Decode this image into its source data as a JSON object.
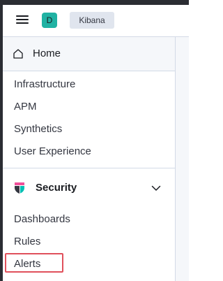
{
  "header": {
    "menu_icon": "hamburger-menu-icon",
    "space_avatar_letter": "D",
    "space_avatar_color": "#20b2a3",
    "app_badge": "Kibana"
  },
  "nav": {
    "home": {
      "icon": "home-icon",
      "label": "Home"
    },
    "observability_items": [
      {
        "label": "Infrastructure"
      },
      {
        "label": "APM"
      },
      {
        "label": "Synthetics"
      },
      {
        "label": "User Experience"
      }
    ],
    "security": {
      "icon": "security-logo-icon",
      "label": "Security",
      "expanded": true,
      "items": [
        {
          "label": "Dashboards"
        },
        {
          "label": "Rules"
        },
        {
          "label": "Alerts"
        }
      ]
    }
  },
  "colors": {
    "highlight_border": "#e0505b",
    "security_pink": "#f04e98",
    "security_teal": "#00bfb3",
    "security_dark": "#343741"
  }
}
